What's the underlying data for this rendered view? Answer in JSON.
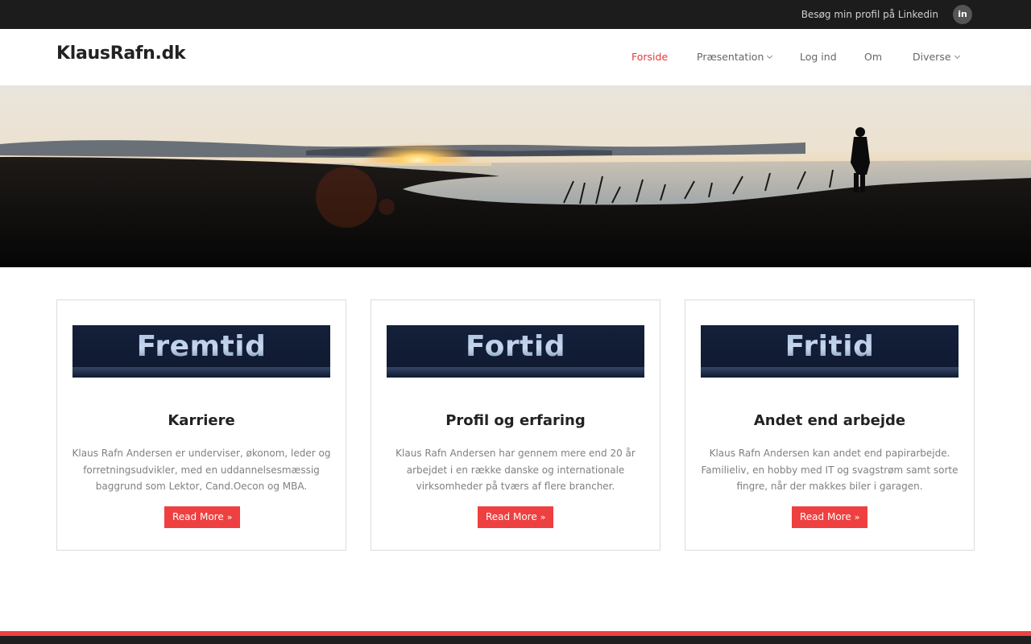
{
  "topbar": {
    "linkedin_text": "Besøg min profil på Linkedin",
    "linkedin_icon": "in"
  },
  "header": {
    "logo": "KlausRafn.dk",
    "nav": [
      {
        "label": "Forside",
        "active": true
      },
      {
        "label": "Præsentation",
        "dropdown": true
      },
      {
        "label": "Log ind"
      },
      {
        "label": "Om"
      },
      {
        "label": "Diverse",
        "dropdown": true
      }
    ]
  },
  "cards": [
    {
      "banner": "Fremtid",
      "title": "Karriere",
      "text": "Klaus Rafn Andersen er underviser, økonom, leder og forretningsudvikler, med en uddannelsesmæssig baggrund som Lektor, Cand.Oecon og MBA.",
      "button": "Read More"
    },
    {
      "banner": "Fortid",
      "title": "Profil og erfaring",
      "text": "Klaus Rafn Andersen har gennem mere end 20 år arbejdet i en række danske og internationale virksomheder på tværs af flere brancher.",
      "button": "Read More"
    },
    {
      "banner": "Fritid",
      "title": "Andet end arbejde",
      "text": "Klaus Rafn Andersen kan andet end papirarbejde. Familieliv, en hobby med IT og svagstrøm samt sorte fingre, når der makkes biler i garagen.",
      "button": "Read More"
    }
  ],
  "colors": {
    "accent": "#ee4040",
    "topbar": "#1c1c1c",
    "banner": "#14203a"
  }
}
